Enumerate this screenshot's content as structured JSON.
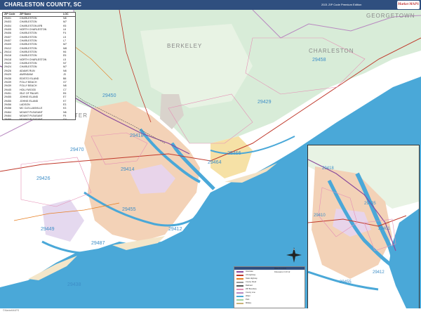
{
  "header": {
    "title": "CHARLESTON COUNTY, SC",
    "edition": "2021 ZIP Code Premium Edition",
    "logo": "Market MAPS"
  },
  "colors": {
    "header_bg": "#2f4f7f",
    "water": "#4aa8d8",
    "land_white": "#ffffff",
    "zip_label": "#3e8ec7",
    "forest_green": "#cfe6d2",
    "urban_peach": "#f3c9a8",
    "marsh_gray": "#e6e6e0"
  },
  "zip_index": {
    "headers": [
      "ZIP Code",
      "ZIP Name",
      "LOC"
    ],
    "rows": [
      [
        "29401",
        "CHARLESTON",
        "N8"
      ],
      [
        "29403",
        "CHARLESTON",
        "M7"
      ],
      [
        "29404",
        "CHARLESTON AFB",
        "K5"
      ],
      [
        "29405",
        "NORTH CHARLESTON",
        "L6"
      ],
      [
        "29406",
        "CHARLESTON",
        "F4"
      ],
      [
        "29407",
        "CHARLESTON",
        "L5"
      ],
      [
        "29407",
        "CHARLESTON",
        "L7"
      ],
      [
        "29409",
        "CHARLESTON",
        "M7"
      ],
      [
        "29412",
        "CHARLESTON",
        "M8"
      ],
      [
        "29414",
        "CHARLESTON",
        "K6"
      ],
      [
        "29418",
        "CHARLESTON",
        "E5"
      ],
      [
        "29418",
        "NORTH CHARLESTON",
        "L5"
      ],
      [
        "29420",
        "CHARLESTON",
        "N7"
      ],
      [
        "29424",
        "CHARLESTON",
        "M7"
      ],
      [
        "29426",
        "ADAMS RUN",
        "N8"
      ],
      [
        "29429",
        "AWENDAW",
        "J3"
      ],
      [
        "29438",
        "EDISTO ISLAND",
        "B8"
      ],
      [
        "29439",
        "FOLLY BEACH",
        "G7"
      ],
      [
        "29439",
        "FOLLY BEACH",
        "N8"
      ],
      [
        "29445",
        "HOLLYWOOD",
        "C7"
      ],
      [
        "29451",
        "ISLE OF PALMS",
        "E6"
      ],
      [
        "29455",
        "JOHNS ISLAND",
        "E7"
      ],
      [
        "29455",
        "JOHNS ISLAND",
        "K7"
      ],
      [
        "29456",
        "LADSON",
        "E3"
      ],
      [
        "29458",
        "MC CLELLANVILLE",
        "K3"
      ],
      [
        "29464",
        "MOUNT PLEASANT",
        "N6"
      ],
      [
        "29464",
        "MOUNT PLEASANT",
        "F5"
      ],
      [
        "29466",
        "MOUNT PLEASANT",
        "G4"
      ],
      [
        "29470",
        "RAVENEL",
        "C6"
      ],
      [
        "29482",
        "SULLIVANS ISLAND",
        "H6"
      ],
      [
        "29487",
        "WADMALAW ISLAND",
        "D8"
      ]
    ]
  },
  "places": {
    "berkeley": "BERKELEY",
    "charleston": "CHARLESTON",
    "georgetown": "GEORGETOWN",
    "ter": "TER"
  },
  "zip_labels": {
    "z29458": "29458",
    "z29450": "29450",
    "z29429": "29429",
    "z29470": "29470",
    "z29426": "29426",
    "z29414": "29414",
    "z29455": "29455",
    "z29449": "29449",
    "z29412": "29412",
    "z29487": "29487",
    "z29438": "29438",
    "z29466": "29466",
    "z29464": "29464",
    "z29418": "29418",
    "inset_29418": "29418",
    "inset_29410": "29410",
    "inset_29405": "29405",
    "inset_29412": "29412",
    "inset_29455": "29455",
    "inset_29401": "29401"
  },
  "legend": {
    "rows": [
      "Interstate",
      "US Highway",
      "State Highway",
      "County Road",
      "Railroad",
      "ZIP Boundary",
      "County Line",
      "Water",
      "Park",
      "Military"
    ]
  },
  "scale": {
    "rows": [
      "Miles 0  2  4  6  8",
      "Kilometers 0 4 8 12"
    ]
  },
  "compass": "N",
  "footer": {
    "note": "©MarketMAPS"
  }
}
